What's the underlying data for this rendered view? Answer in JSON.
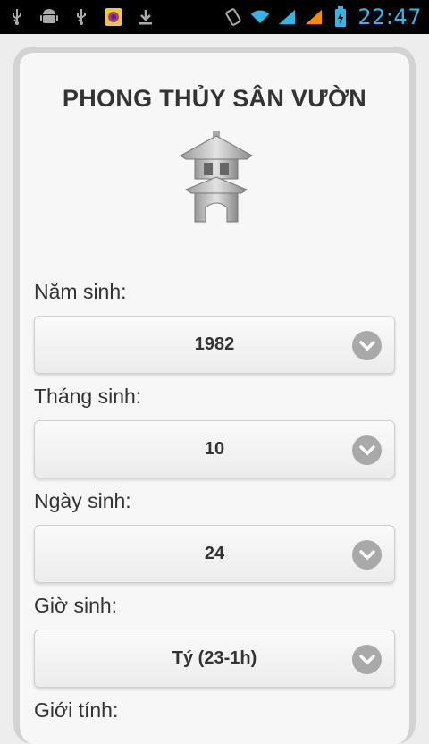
{
  "status_bar": {
    "time": "22:47",
    "left_icons": [
      "usb-icon",
      "android-debug-icon",
      "usb-icon",
      "app-notification-icon",
      "download-icon"
    ],
    "right_icons": [
      "vibrate-icon",
      "wifi-icon",
      "signal-icon",
      "signal-icon",
      "battery-icon"
    ],
    "accent_color": "#33b5e5"
  },
  "app": {
    "title": "PHONG THỦY SÂN VƯỜN"
  },
  "form": {
    "birth_year": {
      "label": "Năm sinh:",
      "value": "1982"
    },
    "birth_month": {
      "label": "Tháng sinh:",
      "value": "10"
    },
    "birth_day": {
      "label": "Ngày sinh:",
      "value": "24"
    },
    "birth_hour": {
      "label": "Giờ sinh:",
      "value": "Tý (23-1h)"
    },
    "gender": {
      "label": "Giới tính:"
    }
  }
}
